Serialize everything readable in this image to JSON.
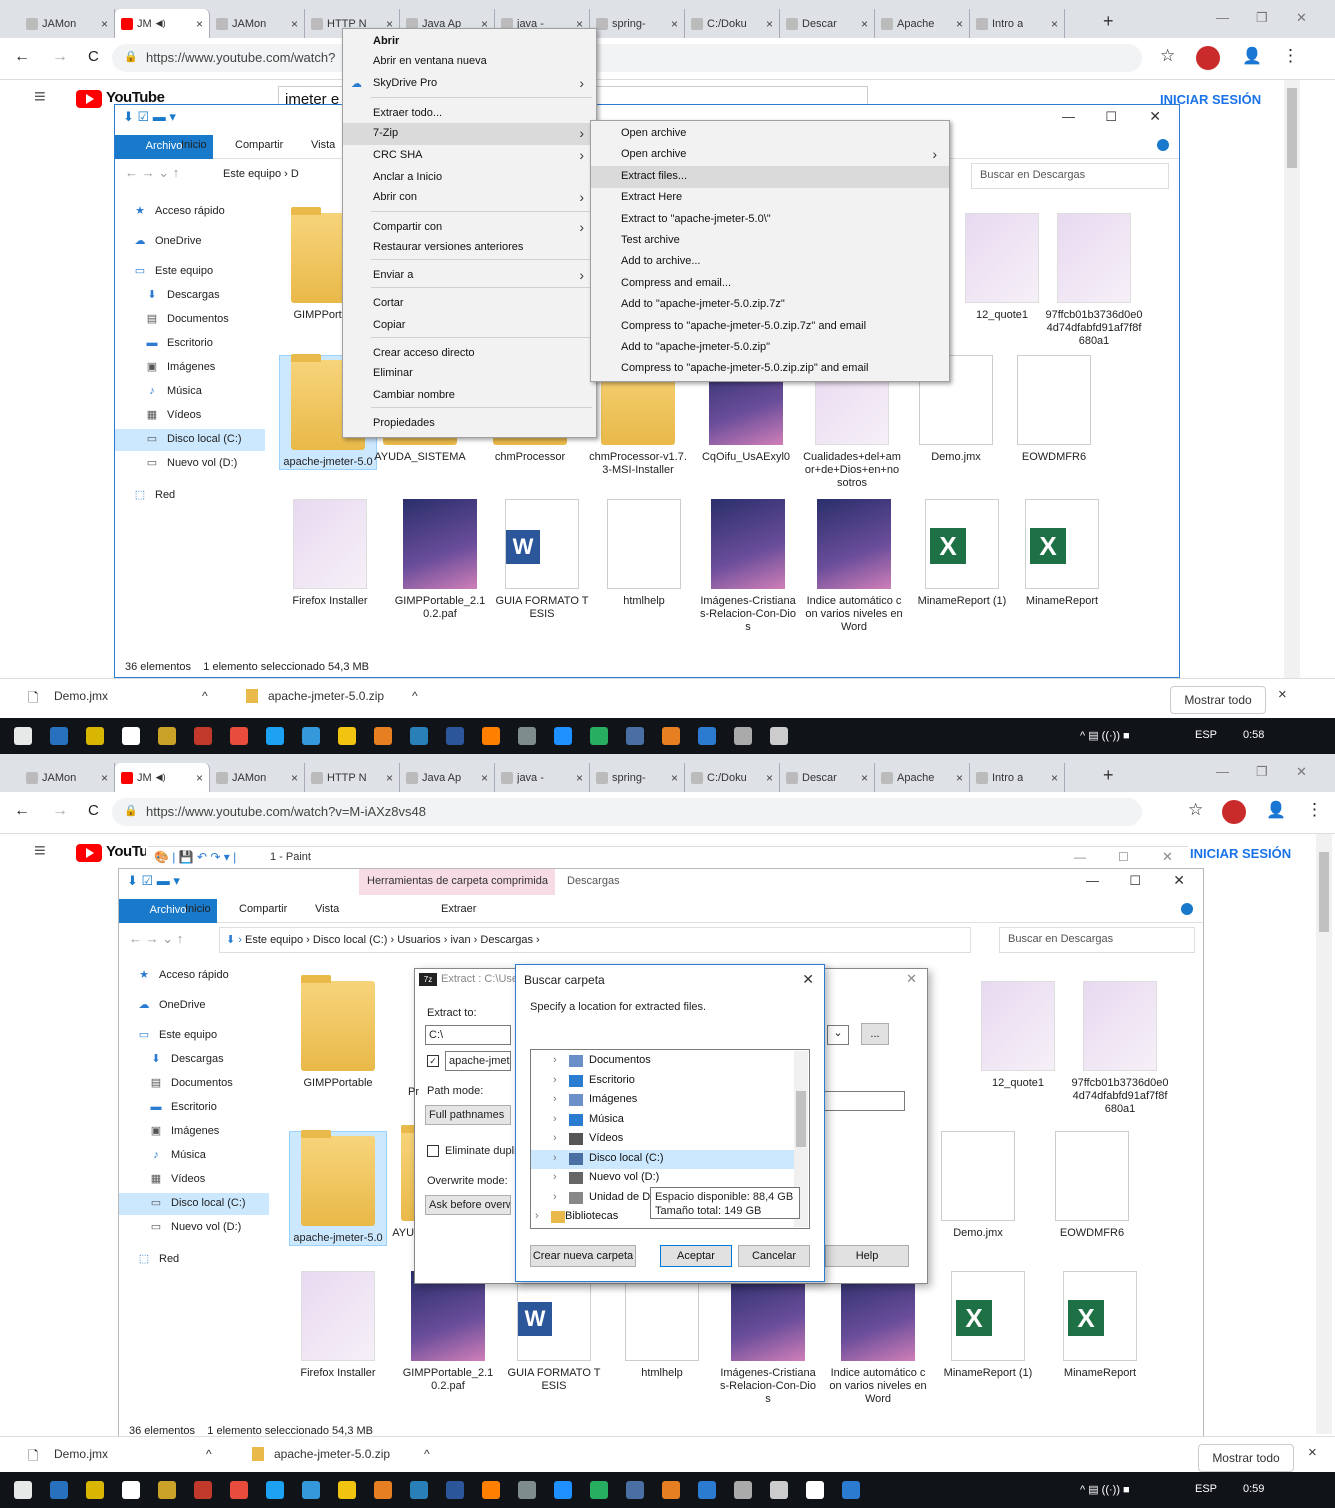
{
  "browser": {
    "tabs": [
      {
        "label": "JAMon",
        "icon": "page-icon"
      },
      {
        "label": "JM",
        "icon": "youtube-icon",
        "audio": true
      },
      {
        "label": "JAMon",
        "icon": "page-icon"
      },
      {
        "label": "HTTP N",
        "icon": "page-icon"
      },
      {
        "label": "Java Ap",
        "icon": "java-icon"
      },
      {
        "label": "java - ",
        "icon": "stackoverflow-icon"
      },
      {
        "label": "spring-",
        "icon": "github-icon"
      },
      {
        "label": "C:/Doku",
        "icon": "file-icon"
      },
      {
        "label": "Descar",
        "icon": "download-icon"
      },
      {
        "label": "Apache",
        "icon": "apache-icon"
      },
      {
        "label": "Intro a",
        "icon": "book-icon"
      }
    ],
    "new_tab": "+",
    "close_glyph": "×",
    "url_top": "https://www.youtube.com/watch?",
    "url_bottom": "https://www.youtube.com/watch?v=M-iAXz8vs48",
    "lock": "🔒",
    "back": "←",
    "forward": "→",
    "reload": "C",
    "star": "☆",
    "menu": "⋮",
    "profile": "👤"
  },
  "youtube": {
    "logo_text": "YouTube",
    "search_value": "jmeter e",
    "signin": "INICIAR SESIÓN",
    "hamburger": "≡"
  },
  "explorer": {
    "ribbon_tabs": [
      "Archivo",
      "Inicio",
      "Compartir",
      "Vista"
    ],
    "extract_tab": "Extraer",
    "contextual_tab": "Herramientas de carpeta comprimida",
    "window_title": "Descargas",
    "breadcrumb_top": [
      "Este equipo",
      "D"
    ],
    "breadcrumb_bottom": [
      "Este equipo",
      "Disco local (C:)",
      "Usuarios",
      "ivan",
      "Descargas"
    ],
    "search_placeholder": "Buscar en Descargas",
    "nav": [
      {
        "label": "Acceso rápido",
        "icon": "star-icon"
      },
      {
        "label": "OneDrive",
        "icon": "cloud-icon"
      },
      {
        "label": "Este equipo",
        "icon": "computer-icon"
      },
      {
        "label": "Descargas",
        "icon": "download-arrow-icon"
      },
      {
        "label": "Documentos",
        "icon": "document-icon"
      },
      {
        "label": "Escritorio",
        "icon": "desktop-icon"
      },
      {
        "label": "Imágenes",
        "icon": "pictures-icon"
      },
      {
        "label": "Música",
        "icon": "music-icon"
      },
      {
        "label": "Vídeos",
        "icon": "video-icon"
      },
      {
        "label": "Disco local (C:)",
        "icon": "drive-icon"
      },
      {
        "label": "Nuevo vol (D:)",
        "icon": "drive-icon"
      },
      {
        "label": "Red",
        "icon": "network-icon"
      }
    ],
    "files_row1": [
      "GIMPPortable",
      "12_quote1",
      "97ffcb01b3736d0e04d74dfabfd91af7f8f680a1"
    ],
    "files_row2": [
      "apache-jmeter-5.0",
      "AYUDA_SISTEMA",
      "chmProcessor",
      "chmProcessor-v1.7.3-MSI-Installer",
      "CqOifu_UsAExyl0",
      "Cualidades+del+amor+de+Dios+en+nosotros",
      "Demo.jmx",
      "EOWDMFR6"
    ],
    "files_row3": [
      "Firefox Installer",
      "GIMPPortable_2.10.2.paf",
      "GUIA FORMATO TESIS",
      "htmlhelp",
      "Imágenes-Cristianas-Relacion-Con-Dios",
      "Indice automático con varios niveles en Word",
      "MinameReport (1)",
      "MinameReport"
    ],
    "status_count": "36 elementos",
    "status_sel": "1 elemento seleccionado  54,3 MB"
  },
  "context_menu": {
    "items": [
      "Abrir",
      "Abrir en ventana nueva",
      "SkyDrive Pro",
      "Extraer todo...",
      "7-Zip",
      "CRC SHA",
      "Anclar a Inicio",
      "Abrir con",
      "Compartir con",
      "Restaurar versiones anteriores",
      "Enviar a",
      "Cortar",
      "Copiar",
      "Crear acceso directo",
      "Eliminar",
      "Cambiar nombre",
      "Propiedades"
    ],
    "submenu": [
      "Open archive",
      "Open archive",
      "Extract files...",
      "Extract Here",
      "Extract to \"apache-jmeter-5.0\\\"",
      "Test archive",
      "Add to archive...",
      "Compress and email...",
      "Add to \"apache-jmeter-5.0.zip.7z\"",
      "Compress to \"apache-jmeter-5.0.zip.7z\" and email",
      "Add to \"apache-jmeter-5.0.zip\"",
      "Compress to \"apache-jmeter-5.0.zip.zip\" and email"
    ]
  },
  "paint": {
    "title": "1 - Paint"
  },
  "extract_dialog": {
    "title": "Extract : C:\\Use",
    "extract_to_label": "Extract to:",
    "extract_to_value": "C:\\",
    "checkbox_label": "apache-jmeter",
    "path_mode_label": "Path mode:",
    "path_mode_value": "Full pathnames",
    "eliminate_label": "Eliminate duplica",
    "overwrite_label": "Overwrite mode:",
    "overwrite_value": "Ask before overwr",
    "browse": "...",
    "help": "Help",
    "partial_p": "Pr"
  },
  "browse_dialog": {
    "title": "Buscar carpeta",
    "prompt": "Specify a location for extracted files.",
    "tree": [
      "Documentos",
      "Escritorio",
      "Imágenes",
      "Música",
      "Vídeos",
      "Disco local (C:)",
      "Nuevo vol (D:)",
      "Unidad de D",
      "Bibliotecas"
    ],
    "tooltip_free": "Espacio disponible: 88,4 GB",
    "tooltip_total": "Tamaño total: 149 GB",
    "new_folder": "Crear nueva carpeta",
    "ok": "Aceptar",
    "cancel": "Cancelar"
  },
  "downloads_bar": {
    "item1": "Demo.jmx",
    "item2": "apache-jmeter-5.0.zip",
    "show_all": "Mostrar todo"
  },
  "taskbar": {
    "lang": "ESP",
    "time_top": "0:58",
    "time_bottom": "0:59"
  },
  "colors": {
    "accent": "#1979ca",
    "youtube_red": "#ff0000",
    "contextual_tab": "#f7dce6",
    "selection": "#cce8ff"
  }
}
